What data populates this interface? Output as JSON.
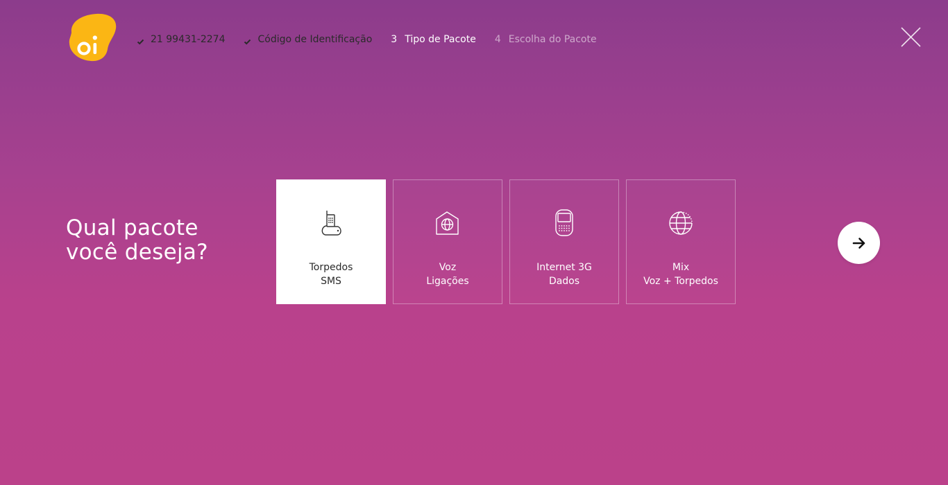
{
  "brand": {
    "logo_text": "oi",
    "logo_color": "#fbb614"
  },
  "steps": [
    {
      "number": "1",
      "label": "21 99431-2274",
      "state": "done"
    },
    {
      "number": "2",
      "label": "Código de Identificação",
      "state": "done"
    },
    {
      "number": "3",
      "label": "Tipo de Pacote",
      "state": "current"
    },
    {
      "number": "4",
      "label": "Escolha do Pacote",
      "state": "future"
    }
  ],
  "question": {
    "line1": "Qual pacote",
    "line2": "você deseja?"
  },
  "options": [
    {
      "title": "Torpedos",
      "subtitle": "SMS",
      "icon": "sms-phone-icon",
      "selected": true
    },
    {
      "title": "Voz",
      "subtitle": "Ligações",
      "icon": "voice-globe-icon",
      "selected": false
    },
    {
      "title": "Internet 3G",
      "subtitle": "Dados",
      "icon": "mobile-keypad-icon",
      "selected": false
    },
    {
      "title": "Mix",
      "subtitle": "Voz + Torpedos",
      "icon": "globe-icon",
      "selected": false
    }
  ],
  "icons": {
    "close": "close-icon",
    "next": "arrow-right-icon",
    "check": "check-icon"
  },
  "colors": {
    "background_top": "#8c3c8c",
    "background_bottom": "#bb418a",
    "accent": "#fbb614",
    "selected_card": "#ffffff"
  }
}
